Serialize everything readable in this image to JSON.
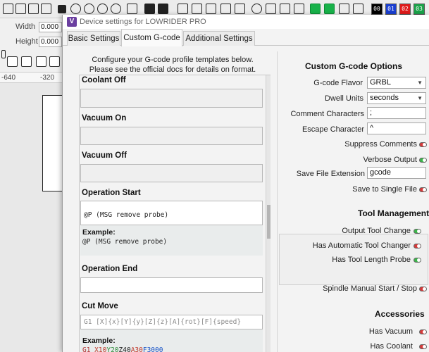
{
  "window": {
    "title": "Device settings for LOWRIDER PRO",
    "logo_letter": "V"
  },
  "tabs": [
    {
      "label": "Basic Settings",
      "active": false
    },
    {
      "label": "Custom G-code",
      "active": true
    },
    {
      "label": "Additional Settings",
      "active": false
    }
  ],
  "intro": {
    "line1": "Configure your G-code profile templates below.",
    "line2": "Please see the official docs for details on format."
  },
  "fields": {
    "coolant_off": {
      "label": "Coolant Off",
      "value": ""
    },
    "vacuum_on": {
      "label": "Vacuum On",
      "value": ""
    },
    "vacuum_off": {
      "label": "Vacuum Off",
      "value": ""
    },
    "operation_start": {
      "label": "Operation Start",
      "value": "@P (MSG remove probe)",
      "example_title": "Example:",
      "example": "@P (MSG remove probe)"
    },
    "operation_end": {
      "label": "Operation End",
      "value": ""
    },
    "cut_move": {
      "label": "Cut Move",
      "placeholder": "G1 [X]{x}[Y]{y}[Z]{z}[A]{rot}[F]{speed}",
      "example_title": "Example:",
      "example_parts": [
        "G1 ",
        "X10",
        "Y20",
        "Z40",
        "A30",
        "F3000"
      ]
    }
  },
  "options": {
    "heading": "Custom G-code Options",
    "gcode_flavor": {
      "label": "G-code Flavor",
      "value": "GRBL"
    },
    "dwell_units": {
      "label": "Dwell Units",
      "value": "seconds"
    },
    "comment_chars": {
      "label": "Comment Characters",
      "value": ";"
    },
    "escape_char": {
      "label": "Escape Character",
      "value": "^"
    },
    "suppress_comments": {
      "label": "Suppress Comments",
      "on": false
    },
    "verbose_output": {
      "label": "Verbose Output",
      "on": true
    },
    "save_ext": {
      "label": "Save File Extension",
      "value": "gcode"
    },
    "save_single": {
      "label": "Save to Single File",
      "on": false
    }
  },
  "tool_management": {
    "heading": "Tool Management",
    "output_tool_change": {
      "label": "Output Tool Change",
      "on": true
    },
    "auto_tool_changer": {
      "label": "Has Automatic Tool Changer",
      "on": false
    },
    "tool_length_probe": {
      "label": "Has Tool Length Probe",
      "on": true
    }
  },
  "spindle": {
    "label": "Spindle Manual Start / Stop",
    "on": false
  },
  "accessories": {
    "heading": "Accessories",
    "has_vacuum": {
      "label": "Has Vacuum",
      "on": false
    },
    "has_coolant": {
      "label": "Has Coolant",
      "on": false
    }
  },
  "background": {
    "width_label": "Width",
    "width_value": "0.000",
    "height_label": "Height",
    "height_value": "0.000",
    "ruler": [
      "-640",
      "-320"
    ],
    "swatches": [
      {
        "label": "00",
        "color": "#000000"
      },
      {
        "label": "01",
        "color": "#1a3fd1"
      },
      {
        "label": "02",
        "color": "#e01b1b"
      },
      {
        "label": "03",
        "color": "#1aa34a"
      }
    ]
  },
  "colors": {
    "accent": "#6b3fa0",
    "toggle_on": "#3cb54a",
    "toggle_off": "#d43a3a"
  }
}
